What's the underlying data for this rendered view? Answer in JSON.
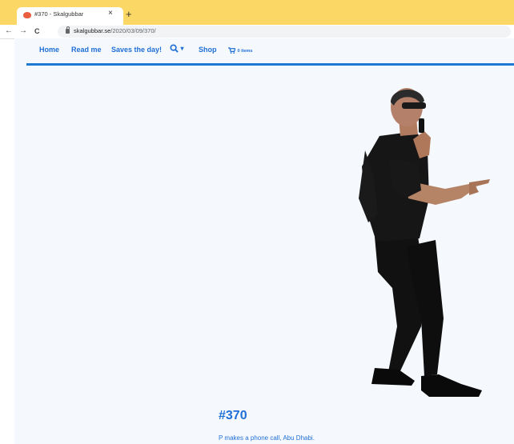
{
  "browser": {
    "tab_title": "#370 - Skalgubbar",
    "tab_close": "×",
    "new_tab": "+",
    "back": "←",
    "forward": "→",
    "reload": "C",
    "url_host": "skalgubbar.se",
    "url_path": "/2020/03/09/370/"
  },
  "nav": {
    "home": "Home",
    "read_me": "Read me",
    "saves_the_day": "Saves the day!",
    "search_caret": "▾",
    "shop": "Shop",
    "cart": "0 items"
  },
  "post": {
    "title": "#370",
    "description": "P makes a phone call, Abu Dhabi."
  },
  "colors": {
    "tabbar": "#fbd765",
    "link": "#1f6ed6",
    "page_bg": "#f5f9fd"
  }
}
